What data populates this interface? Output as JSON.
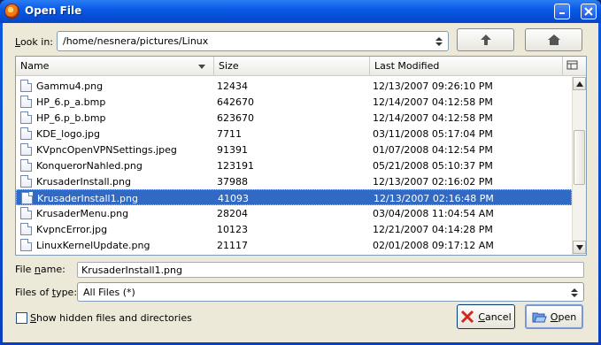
{
  "window": {
    "title": "Open File"
  },
  "lookin": {
    "label": "Look in:",
    "path": "/home/nesnera/pictures/Linux"
  },
  "columns": {
    "name": "Name",
    "size": "Size",
    "modified": "Last Modified"
  },
  "files": [
    {
      "name": "Gammu4.png",
      "size": "12434",
      "modified": "12/13/2007 09:26:10 PM"
    },
    {
      "name": "HP_6.p_a.bmp",
      "size": "642670",
      "modified": "12/14/2007 04:12:58 PM"
    },
    {
      "name": "HP_6.p_b.bmp",
      "size": "623670",
      "modified": "12/14/2007 04:12:58 PM"
    },
    {
      "name": "KDE_logo.jpg",
      "size": "7711",
      "modified": "03/11/2008 05:17:04 PM"
    },
    {
      "name": "KVpncOpenVPNSettings.jpeg",
      "size": "91391",
      "modified": "01/07/2008 04:12:54 PM"
    },
    {
      "name": "KonquerorNahled.png",
      "size": "123191",
      "modified": "05/21/2008 05:10:37 PM"
    },
    {
      "name": "KrusaderInstall.png",
      "size": "37988",
      "modified": "12/13/2007 02:16:02 PM"
    },
    {
      "name": "KrusaderInstall1.png",
      "size": "41093",
      "modified": "12/13/2007 02:16:48 PM"
    },
    {
      "name": "KrusaderMenu.png",
      "size": "28204",
      "modified": "03/04/2008 11:04:54 AM"
    },
    {
      "name": "KvpncError.jpg",
      "size": "10123",
      "modified": "12/21/2007 04:14:28 PM"
    },
    {
      "name": "LinuxKernelUpdate.png",
      "size": "21117",
      "modified": "02/01/2008 09:17:12 AM"
    }
  ],
  "selected_index": 7,
  "filename": {
    "label": "File name:",
    "value": "KrusaderInstall1.png"
  },
  "filetype": {
    "label": "Files of type:",
    "value": "All Files (*)"
  },
  "show_hidden": {
    "label": "Show hidden files and directories",
    "checked": false
  },
  "buttons": {
    "cancel": "Cancel",
    "open": "Open"
  },
  "colors": {
    "selection": "#316ac5",
    "titlebar": "#0a5ae6",
    "dialog_bg": "#ece9d8"
  }
}
